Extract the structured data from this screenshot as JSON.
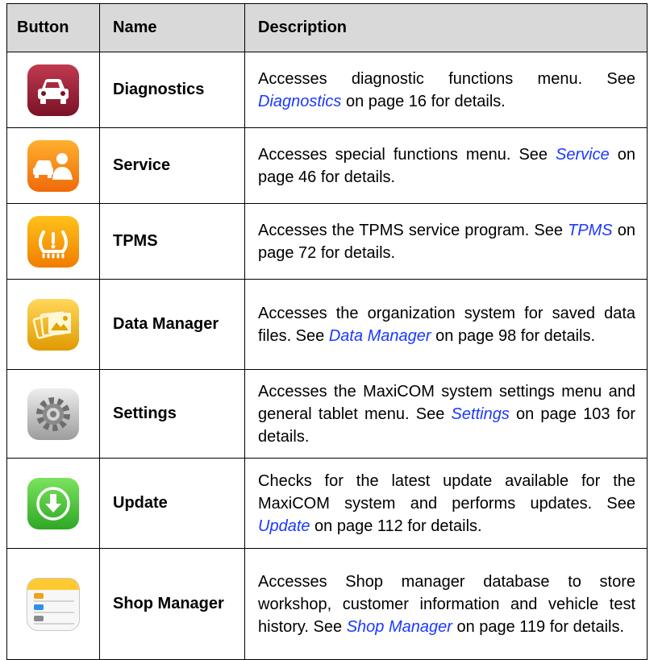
{
  "header": {
    "button": "Button",
    "name": "Name",
    "description": "Description"
  },
  "rows": [
    {
      "icon": "car-icon",
      "name": "Diagnostics",
      "d1": "Accesses diagnostic functions menu. See ",
      "link": "Diagnostics",
      "d2": " on page 16 for details."
    },
    {
      "icon": "car-wrench-icon",
      "name": "Service",
      "d1": "Accesses special functions menu. See ",
      "link": "Service",
      "d2": " on page 46 for details."
    },
    {
      "icon": "tire-pressure-icon",
      "name": "TPMS",
      "d1": "Accesses the TPMS service program. See ",
      "link": "TPMS",
      "d2": " on page 72 for details."
    },
    {
      "icon": "photo-files-icon",
      "name": "Data Manager",
      "d1": "Accesses the organization system for saved data files. See ",
      "link": "Data Manager",
      "d2": " on page 98 for details."
    },
    {
      "icon": "gear-icon",
      "name": "Settings",
      "d1": "Accesses the MaxiCOM system settings menu and general tablet menu. See ",
      "link": "Settings",
      "d2": " on page 103 for details."
    },
    {
      "icon": "download-icon",
      "name": "Update",
      "d1": "Checks for the latest update available for the MaxiCOM system and performs updates. See ",
      "link": "Update",
      "d2": " on page 112 for details."
    },
    {
      "icon": "notepad-cars-icon",
      "name": "Shop Manager",
      "d1": "Accesses Shop manager database to store workshop, customer information and vehicle test history. See ",
      "link": "Shop Manager",
      "d2": " on page 119 for details."
    }
  ]
}
